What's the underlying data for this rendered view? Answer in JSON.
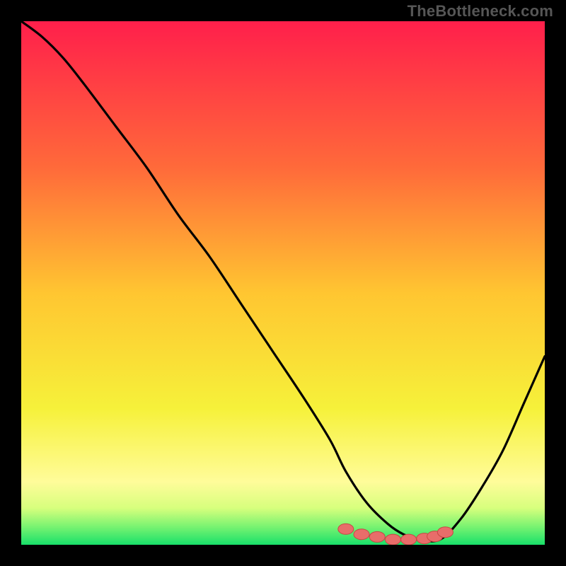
{
  "watermark": "TheBottleneck.com",
  "colors": {
    "red": "#ff1f4b",
    "orange": "#ff9a2a",
    "yellow": "#f6f13a",
    "paleyellow": "#fffc9a",
    "green_light": "#9ffd67",
    "green_deep": "#18e06a",
    "curve": "#000000",
    "dot_fill": "#e86d6a",
    "dot_stroke": "#c74743"
  },
  "chart_data": {
    "type": "line",
    "title": "",
    "xlabel": "",
    "ylabel": "",
    "xlim": [
      0,
      100
    ],
    "ylim": [
      0,
      100
    ],
    "series": [
      {
        "name": "bottleneck-curve",
        "x": [
          0,
          4,
          8,
          12,
          18,
          24,
          30,
          36,
          42,
          48,
          54,
          59,
          62,
          66,
          70,
          73,
          76,
          80,
          84,
          88,
          92,
          96,
          100
        ],
        "y": [
          100,
          97,
          93,
          88,
          80,
          72,
          63,
          55,
          46,
          37,
          28,
          20,
          14,
          8,
          4,
          2,
          1,
          1,
          5,
          11,
          18,
          27,
          36
        ]
      }
    ],
    "markers": {
      "name": "optimal-zone-dots",
      "x": [
        62,
        65,
        68,
        71,
        74,
        77,
        79,
        81
      ],
      "y": [
        3,
        2,
        1.5,
        1,
        1,
        1.2,
        1.6,
        2.4
      ]
    }
  }
}
